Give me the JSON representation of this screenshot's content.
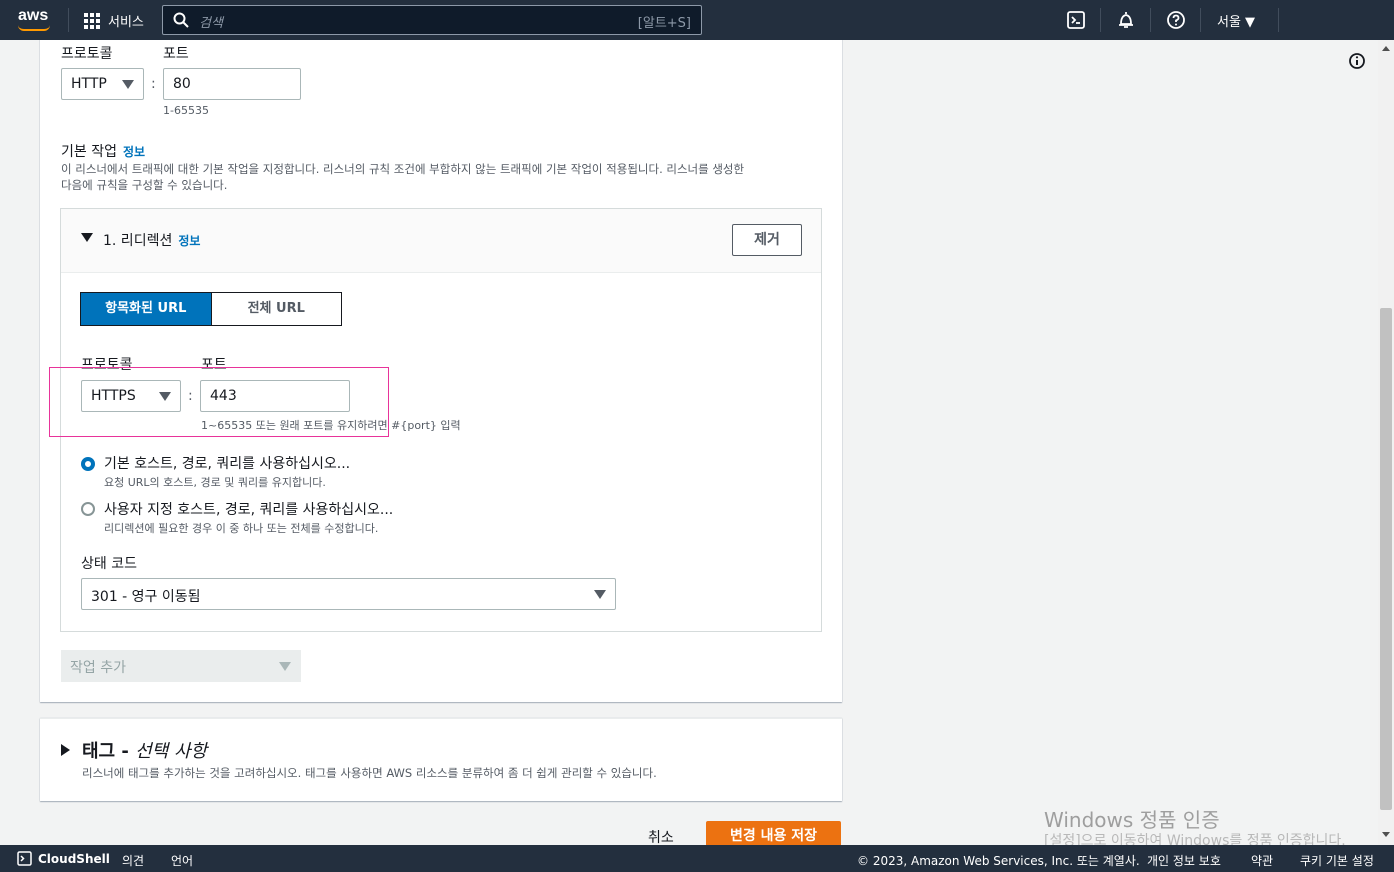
{
  "topbar": {
    "logo": "aws",
    "services_label": "서비스",
    "search_placeholder": "검색",
    "search_shortcut": "[알트+S]",
    "region": "서울 ▼",
    "icons": [
      "cloudshell-icon",
      "bell-icon",
      "help-icon"
    ]
  },
  "listener": {
    "protocol_label": "프로토콜",
    "port_label": "포트",
    "protocol_value": "HTTP",
    "port_value": "80",
    "port_hint": "1-65535"
  },
  "default_action": {
    "title": "기본 작업",
    "info_link": "정보",
    "description_line1": "이 리스너에서 트래픽에 대한 기본 작업을 지정합니다. 리스너의 규칙 조건에 부합하지 않는 트래픽에 기본 작업이 적용됩니다. 리스너를 생성한",
    "description_line2": "다음에 규칙을 구성할 수 있습니다."
  },
  "redirect": {
    "title": "1. 리디렉션",
    "info_link": "정보",
    "remove_button": "제거",
    "tabs": [
      "항목화된 URL",
      "전체 URL"
    ],
    "protocol_label": "프로토콜",
    "port_label": "포트",
    "protocol_value": "HTTPS",
    "port_value": "443",
    "port_hint": "1~65535 또는 원래 포트를 유지하려면 #{port} 입력",
    "option1_label": "기본 호스트, 경로, 쿼리를 사용하십시오...",
    "option1_desc": "요청 URL의 호스트, 경로 및 쿼리를 유지합니다.",
    "option2_label": "사용자 지정 호스트, 경로, 쿼리를 사용하십시오...",
    "option2_desc": "리디렉션에 필요한 경우 이 중 하나 또는 전체를 수정합니다.",
    "status_label": "상태 코드",
    "status_value": "301 - 영구 이동됨",
    "add_action": "작업 추가"
  },
  "tags": {
    "title": "태그 - ",
    "optional": "선택 사항",
    "description": "리스너에 태그를 추가하는 것을 고려하십시오. 태그를 사용하면 AWS 리소스를 분류하여 좀 더 쉽게 관리할 수 있습니다."
  },
  "actions": {
    "cancel": "취소",
    "save": "변경 내용 저장"
  },
  "footer": {
    "cloudshell": "CloudShell",
    "feedback": "의견",
    "language": "언어",
    "copyright": "© 2023, Amazon Web Services, Inc. 또는 계열사.",
    "privacy": "개인 정보 보호",
    "terms": "약관",
    "cookies": "쿠키 기본 설정"
  },
  "watermark": {
    "line1": "Windows 정품 인증",
    "line2": "[설정]으로 이동하여 Windows를 정품 인증합니다."
  }
}
